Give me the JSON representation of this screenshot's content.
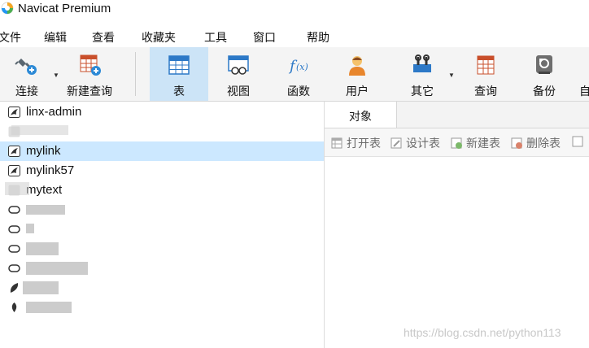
{
  "window": {
    "title": "Navicat Premium"
  },
  "menu": [
    "文件",
    "编辑",
    "查看",
    "收藏夹",
    "工具",
    "窗口",
    "帮助"
  ],
  "toolbar": {
    "connect": "连接",
    "new_query": "新建查询",
    "table": "表",
    "view": "视图",
    "function": "函数",
    "user": "用户",
    "other": "其它",
    "query": "查询",
    "backup": "备份",
    "cut": "自"
  },
  "connections": [
    "linx-admin",
    "",
    "mylink",
    "mylink57",
    "mytext"
  ],
  "tab": {
    "objects": "对象"
  },
  "object_toolbar": {
    "open_table": "打开表",
    "design_table": "设计表",
    "new_table": "新建表",
    "delete_table": "删除表"
  },
  "watermark": "https://blog.csdn.net/python113",
  "colors": {
    "selected_row": "#cce8ff",
    "active_toolbar": "#cce4f7",
    "toolbar_bg": "#f4f4f4"
  }
}
